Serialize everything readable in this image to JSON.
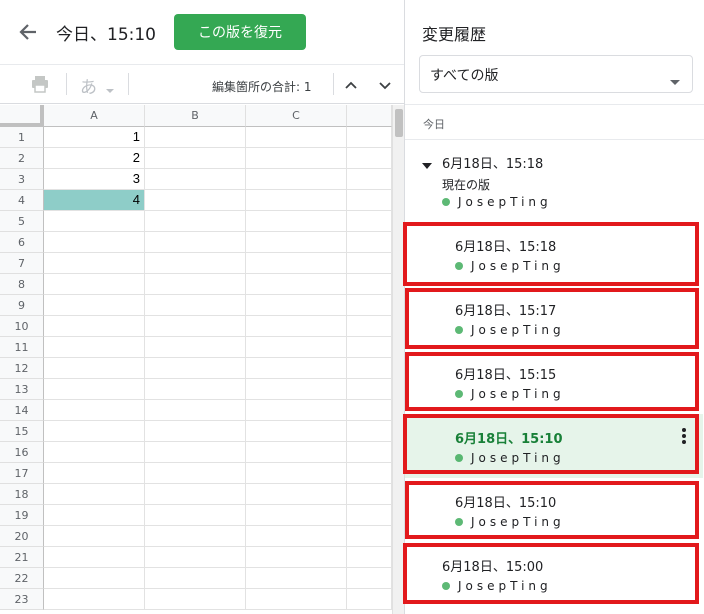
{
  "header": {
    "title": "今日、15:10",
    "restore_label": "この版を復元"
  },
  "toolbar": {
    "input_glyph": "あ",
    "edit_count": "編集箇所の合計: 1"
  },
  "sheet": {
    "columns": [
      "A",
      "B",
      "C"
    ],
    "rows": [
      "1",
      "2",
      "3",
      "4",
      "5",
      "6",
      "7",
      "8",
      "9",
      "10",
      "11",
      "12",
      "13",
      "14",
      "15",
      "16",
      "17",
      "18",
      "19",
      "20",
      "21",
      "22",
      "23"
    ],
    "values": [
      "1",
      "2",
      "3",
      "4"
    ],
    "highlight_color": "#8ecdc8"
  },
  "panel": {
    "title": "変更履歴",
    "filter": "すべての版",
    "section": "今日",
    "current": {
      "time": "6月18日、15:18",
      "label": "現在の版",
      "author": "JosepTing"
    },
    "versions": [
      {
        "time": "6月18日、15:18",
        "author": "JosepTing"
      },
      {
        "time": "6月18日、15:17",
        "author": "JosepTing"
      },
      {
        "time": "6月18日、15:15",
        "author": "JosepTing"
      },
      {
        "time": "6月18日、15:10",
        "author": "JosepTing"
      },
      {
        "time": "6月18日、15:10",
        "author": "JosepTing"
      },
      {
        "time": "6月18日、15:00",
        "author": "JosepTing"
      }
    ]
  },
  "colors": {
    "accent_green": "#34a853",
    "selected_bg": "#e6f4ea",
    "annotation_red": "#e2191c"
  }
}
